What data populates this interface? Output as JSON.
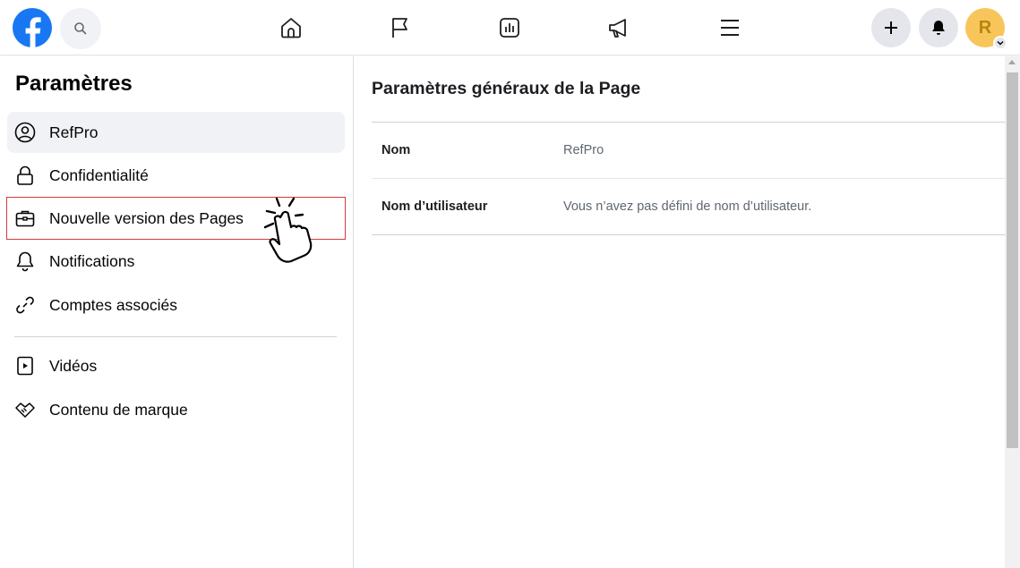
{
  "header": {
    "logo_icon": "facebook-logo-icon",
    "search_icon": "search-icon",
    "nav_icons": [
      "home-icon",
      "flag-icon",
      "insights-icon",
      "megaphone-icon",
      "menu-icon"
    ],
    "create_icon": "plus-icon",
    "notifications_icon": "bell-icon",
    "avatar_letter": "R",
    "brand_color": "#1877f2"
  },
  "sidebar": {
    "title": "Paramètres",
    "items": [
      {
        "label": "RefPro",
        "icon": "user-circle-icon"
      },
      {
        "label": "Confidentialité",
        "icon": "lock-icon"
      },
      {
        "label": "Nouvelle version des Pages",
        "icon": "briefcase-icon"
      },
      {
        "label": "Notifications",
        "icon": "bell-outline-icon"
      },
      {
        "label": "Comptes associés",
        "icon": "link-icon"
      },
      {
        "label": "Vidéos",
        "icon": "video-icon"
      },
      {
        "label": "Contenu de marque",
        "icon": "handshake-icon"
      }
    ]
  },
  "main": {
    "title": "Paramètres généraux de la Page",
    "rows": [
      {
        "key": "Nom",
        "value": "RefPro"
      },
      {
        "key": "Nom d’utilisateur",
        "value": "Vous n’avez pas défini de nom d’utilisateur."
      }
    ]
  }
}
